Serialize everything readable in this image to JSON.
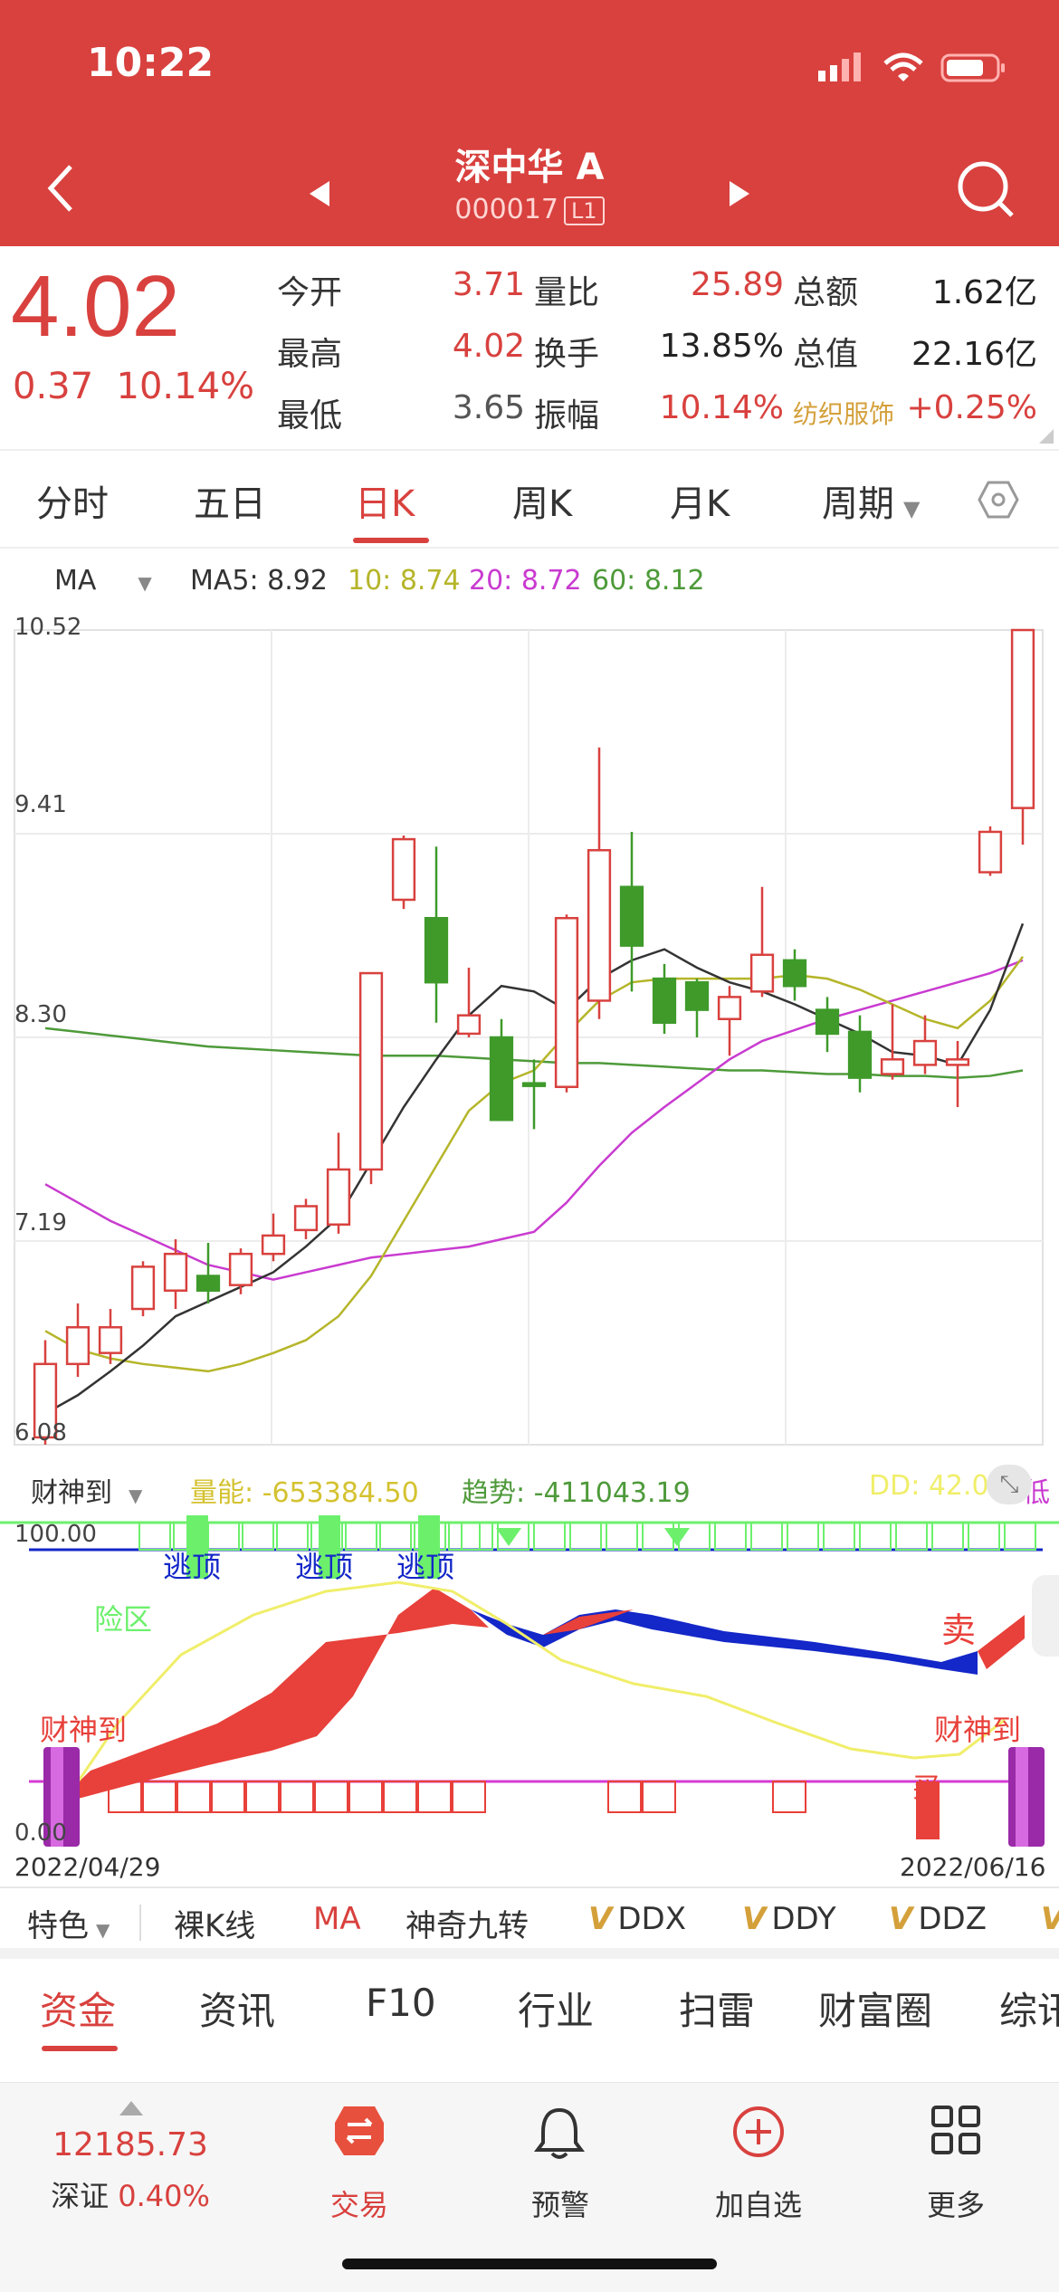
{
  "status": {
    "time": "10:22"
  },
  "nav": {
    "title": "深中华 A",
    "code": "000017",
    "level": "L1"
  },
  "quote": {
    "price": "4.02",
    "change": "0.37",
    "change_pct": "10.14%",
    "rows": [
      {
        "l1": "今开",
        "v1": "3.71",
        "l2": "量比",
        "v2": "25.89",
        "l3": "总额",
        "v3": "1.62亿"
      },
      {
        "l1": "最高",
        "v1": "4.02",
        "l2": "换手",
        "v2": "13.85%",
        "l3": "总值",
        "v3": "22.16亿"
      },
      {
        "l1": "最低",
        "v1": "3.65",
        "l2": "振幅",
        "v2": "10.14%",
        "l3": "纺织服饰",
        "v3": "+0.25%"
      }
    ]
  },
  "tabs": [
    "分时",
    "五日",
    "日K",
    "周K",
    "月K",
    "周期"
  ],
  "active_tab": "日K",
  "ma": {
    "selector": "MA",
    "ma5": "MA5: 8.92",
    "ma10": "10: 8.74",
    "ma20": "20: 8.72",
    "ma60": "60: 8.12",
    "colors": {
      "ma5": "#333333",
      "ma10": "#b5b52a",
      "ma20": "#c93bd0",
      "ma60": "#4e9a3a"
    }
  },
  "chart_data": {
    "type": "candlestick",
    "ylim": [
      6.08,
      10.52
    ],
    "y_ticks": [
      "10.52",
      "9.41",
      "8.30",
      "7.19",
      "6.08"
    ],
    "x_start": "2022/04/29",
    "x_end": "2022/06/16",
    "candles": [
      {
        "o": 6.12,
        "c": 6.52,
        "h": 6.65,
        "l": 6.08,
        "up": true
      },
      {
        "o": 6.52,
        "c": 6.72,
        "h": 6.85,
        "l": 6.45,
        "up": true
      },
      {
        "o": 6.58,
        "c": 6.72,
        "h": 6.82,
        "l": 6.52,
        "up": true
      },
      {
        "o": 6.82,
        "c": 7.05,
        "h": 7.08,
        "l": 6.78,
        "up": true
      },
      {
        "o": 6.92,
        "c": 7.12,
        "h": 7.2,
        "l": 6.82,
        "up": true
      },
      {
        "o": 7.0,
        "c": 6.92,
        "h": 7.18,
        "l": 6.85,
        "up": false
      },
      {
        "o": 6.95,
        "c": 7.12,
        "h": 7.15,
        "l": 6.9,
        "up": true
      },
      {
        "o": 7.12,
        "c": 7.22,
        "h": 7.34,
        "l": 7.08,
        "up": true
      },
      {
        "o": 7.25,
        "c": 7.38,
        "h": 7.42,
        "l": 7.2,
        "up": true
      },
      {
        "o": 7.28,
        "c": 7.58,
        "h": 7.78,
        "l": 7.23,
        "up": true
      },
      {
        "o": 7.58,
        "c": 8.65,
        "h": 8.65,
        "l": 7.5,
        "up": true
      },
      {
        "o": 9.05,
        "c": 9.38,
        "h": 9.4,
        "l": 9.0,
        "up": true
      },
      {
        "o": 8.95,
        "c": 8.6,
        "h": 9.34,
        "l": 8.38,
        "up": false
      },
      {
        "o": 8.32,
        "c": 8.42,
        "h": 8.68,
        "l": 8.3,
        "up": true
      },
      {
        "o": 8.3,
        "c": 7.85,
        "h": 8.4,
        "l": 7.85,
        "up": false
      },
      {
        "o": 8.05,
        "c": 8.04,
        "h": 8.18,
        "l": 7.8,
        "up": false
      },
      {
        "o": 8.03,
        "c": 8.95,
        "h": 8.97,
        "l": 8.0,
        "up": true
      },
      {
        "o": 8.5,
        "c": 9.32,
        "h": 9.88,
        "l": 8.4,
        "up": true
      },
      {
        "o": 9.12,
        "c": 8.8,
        "h": 9.42,
        "l": 8.55,
        "up": false
      },
      {
        "o": 8.62,
        "c": 8.38,
        "h": 8.7,
        "l": 8.32,
        "up": false
      },
      {
        "o": 8.6,
        "c": 8.45,
        "h": 8.62,
        "l": 8.3,
        "up": false
      },
      {
        "o": 8.4,
        "c": 8.52,
        "h": 8.58,
        "l": 8.2,
        "up": true
      },
      {
        "o": 8.55,
        "c": 8.75,
        "h": 9.12,
        "l": 8.52,
        "up": true
      },
      {
        "o": 8.72,
        "c": 8.58,
        "h": 8.78,
        "l": 8.5,
        "up": false
      },
      {
        "o": 8.45,
        "c": 8.32,
        "h": 8.52,
        "l": 8.22,
        "up": false
      },
      {
        "o": 8.33,
        "c": 8.08,
        "h": 8.42,
        "l": 8.0,
        "up": false
      },
      {
        "o": 8.1,
        "c": 8.18,
        "h": 8.48,
        "l": 8.07,
        "up": true
      },
      {
        "o": 8.15,
        "c": 8.28,
        "h": 8.42,
        "l": 8.1,
        "up": true
      },
      {
        "o": 8.15,
        "c": 8.18,
        "h": 8.28,
        "l": 7.92,
        "up": true
      },
      {
        "o": 9.2,
        "c": 9.42,
        "h": 9.45,
        "l": 9.18,
        "up": true
      },
      {
        "o": 9.55,
        "c": 10.52,
        "h": 10.52,
        "l": 9.35,
        "up": true
      }
    ],
    "ma_lines": {
      "ma5": [
        6.25,
        6.35,
        6.48,
        6.62,
        6.78,
        6.86,
        6.94,
        7.02,
        7.16,
        7.32,
        7.62,
        7.92,
        8.18,
        8.42,
        8.58,
        8.55,
        8.45,
        8.62,
        8.72,
        8.78,
        8.68,
        8.6,
        8.55,
        8.48,
        8.4,
        8.32,
        8.22,
        8.2,
        8.15,
        8.45,
        8.92
      ],
      "ma10": [
        6.7,
        6.6,
        6.55,
        6.52,
        6.5,
        6.48,
        6.52,
        6.58,
        6.65,
        6.78,
        7.0,
        7.3,
        7.6,
        7.9,
        8.05,
        8.12,
        8.32,
        8.5,
        8.6,
        8.62,
        8.62,
        8.62,
        8.62,
        8.64,
        8.62,
        8.56,
        8.48,
        8.4,
        8.35,
        8.5,
        8.74
      ],
      "ma20": [
        7.5,
        7.4,
        7.3,
        7.22,
        7.14,
        7.06,
        7.02,
        6.98,
        7.02,
        7.06,
        7.1,
        7.12,
        7.14,
        7.16,
        7.2,
        7.24,
        7.4,
        7.6,
        7.78,
        7.92,
        8.05,
        8.18,
        8.28,
        8.34,
        8.4,
        8.45,
        8.5,
        8.55,
        8.6,
        8.65,
        8.72
      ],
      "ma60": [
        8.35,
        8.33,
        8.31,
        8.29,
        8.27,
        8.25,
        8.24,
        8.23,
        8.22,
        8.21,
        8.2,
        8.2,
        8.2,
        8.19,
        8.18,
        8.17,
        8.16,
        8.16,
        8.15,
        8.14,
        8.13,
        8.12,
        8.12,
        8.11,
        8.1,
        8.1,
        8.09,
        8.09,
        8.08,
        8.09,
        8.12
      ]
    }
  },
  "indicator": {
    "name": "财神到",
    "volume": "量能: -653384.50",
    "trend": "趋势: -411043.19",
    "dd": "DD: 42.0",
    "dd_tail": "低",
    "top": "100.00",
    "bottom": "0.00",
    "label_top": "逃顶",
    "label_risk": "险区",
    "label_god": "财神到",
    "label_sell": "卖",
    "label_buy": "买",
    "date_start": "2022/04/29",
    "date_end": "2022/06/16",
    "colors": {
      "fill": "#e8403a",
      "blue": "#1427c8",
      "yellow": "#f0ee6a",
      "green": "#6cf06c",
      "magenta": "#d63bd6"
    }
  },
  "features": {
    "first": "特色",
    "items": [
      "裸K线",
      "MA",
      "神奇九转",
      "DDX",
      "DDY",
      "DDZ"
    ]
  },
  "bottom_tabs": [
    "资金",
    "资讯",
    "F10",
    "行业",
    "扫雷",
    "财富圈",
    "综讯"
  ],
  "active_bottom_tab": "资金",
  "tabbar": {
    "index_value": "12185.73",
    "index_name": "深证",
    "index_pct": "0.40%",
    "items": [
      "交易",
      "预警",
      "加自选",
      "更多"
    ]
  }
}
